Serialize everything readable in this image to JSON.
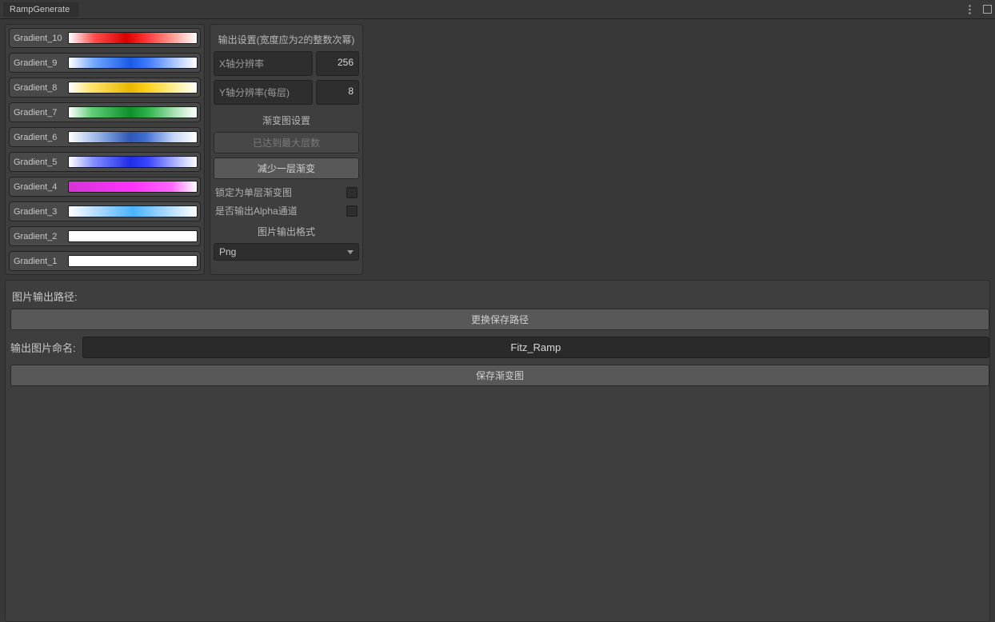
{
  "titlebar": {
    "tab": "RampGenerate"
  },
  "gradients": [
    {
      "label": "Gradient_10",
      "css": "linear-gradient(90deg,#ffffff 0%,#ff4d4d 20%,#d90000 45%,#ff3333 60%,#ffb0a8 85%,#ffffff 100%)"
    },
    {
      "label": "Gradient_9",
      "css": "linear-gradient(90deg,#ffffff 0%,#6fa6ff 20%,#1a5be6 48%,#3f7cff 62%,#b9d0ff 85%,#ffffff 100%)"
    },
    {
      "label": "Gradient_8",
      "css": "linear-gradient(90deg,#ffffff 0%,#ffe367 18%,#e6b800 48%,#ffd21f 62%,#fff2a6 85%,#ffffff 100%)"
    },
    {
      "label": "Gradient_7",
      "css": "linear-gradient(90deg,#ffffff 0%,#5fcf76 18%,#0f8f2a 48%,#2fb34a 62%,#b6e8c0 85%,#ffffff 100%)"
    },
    {
      "label": "Gradient_6",
      "css": "linear-gradient(90deg,#ffffff 0%,#9ab7e8 22%,#2e57b8 48%,#3f6ed4 60%,#c6d7f5 82%,#ffffff 100%)"
    },
    {
      "label": "Gradient_5",
      "css": "linear-gradient(90deg,#ffffff 0%,#7f8cff 20%,#1f2de6 48%,#3946ff 62%,#b7bdff 85%,#ffffff 100%)"
    },
    {
      "label": "Gradient_4",
      "css": "linear-gradient(90deg,#d633d6 0%,#ff33ff 50%,#ff66ff 80%,#ffffff 100%)"
    },
    {
      "label": "Gradient_3",
      "css": "linear-gradient(90deg,#ffffff 0%,#a6d7ff 25%,#49b4ff 50%,#a6d7ff 75%,#ffffff 100%)"
    },
    {
      "label": "Gradient_2",
      "css": "#ffffff"
    },
    {
      "label": "Gradient_1",
      "css": "#ffffff"
    }
  ],
  "settings": {
    "output_title": "输出设置(宽度应为2的整数次幂)",
    "x_res_label": "X轴分辨率",
    "x_res_value": "256",
    "y_res_label": "Y轴分辨率(每层)",
    "y_res_value": "8",
    "ramp_title": "渐变图设置",
    "max_layers_btn": "已达到最大层数",
    "remove_layer_btn": "减少一层渐变",
    "lock_single_label": "锁定为单层渐变图",
    "output_alpha_label": "是否输出Alpha通道",
    "format_title": "图片输出格式",
    "format_value": "Png"
  },
  "output": {
    "path_label": "图片输出路径:",
    "change_path_btn": "更换保存路径",
    "name_label": "输出图片命名:",
    "name_value": "Fitz_Ramp",
    "save_btn": "保存渐变图"
  }
}
